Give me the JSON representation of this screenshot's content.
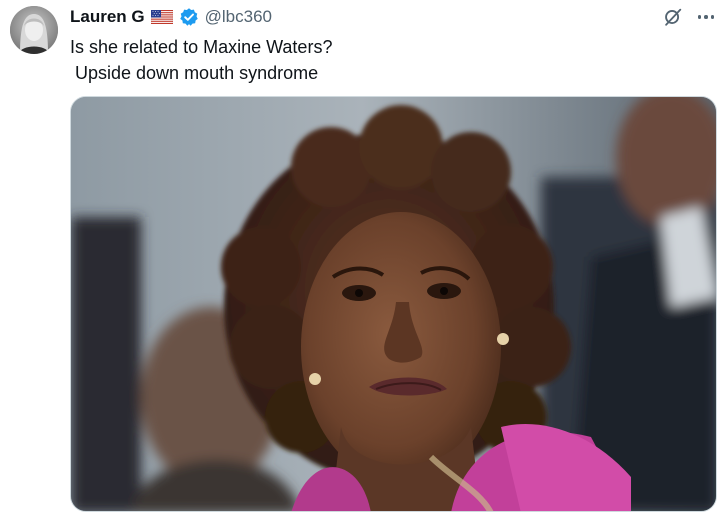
{
  "author": {
    "name": "Lauren G",
    "handle": "@lbc360",
    "flag_icon": "us-flag-icon",
    "verified_icon": "verified-badge-icon",
    "verified_color": "#1d9bf0"
  },
  "post": {
    "text_line1": "Is she related to Maxine Waters?",
    "text_line2": " Upside down mouth syndrome"
  },
  "actions": {
    "grok_icon": "grok-icon",
    "more_icon": "more-options-icon"
  },
  "media": {
    "type": "photo"
  },
  "colors": {
    "text": "#0f1419",
    "secondary": "#536471",
    "accent": "#1d9bf0"
  }
}
